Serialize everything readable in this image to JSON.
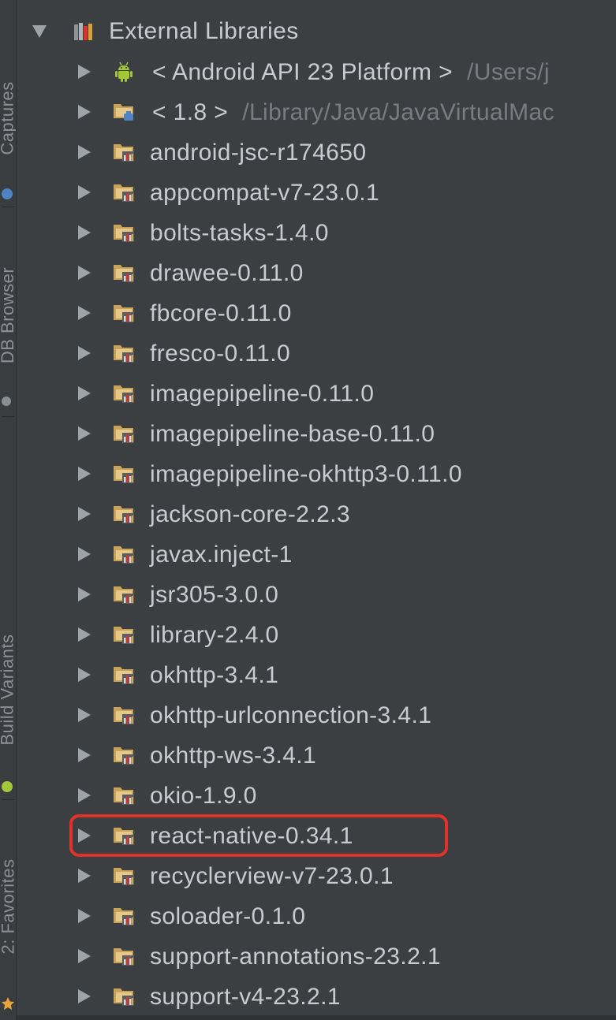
{
  "sidebar": {
    "tabs": [
      {
        "label": "Captures"
      },
      {
        "label": "DB Browser"
      },
      {
        "label": "Build Variants"
      },
      {
        "label": "2: Favorites"
      }
    ]
  },
  "tree": {
    "root": {
      "label": "External Libraries",
      "icon": "libraries-icon",
      "expanded": true
    },
    "items": [
      {
        "label": "< Android API 23 Platform >",
        "path": "/Users/j",
        "icon": "android-icon"
      },
      {
        "label": "< 1.8 >",
        "path": "/Library/Java/JavaVirtualMac",
        "icon": "jdk-folder-icon"
      },
      {
        "label": "android-jsc-r174650",
        "icon": "library-folder-icon"
      },
      {
        "label": "appcompat-v7-23.0.1",
        "icon": "library-folder-icon"
      },
      {
        "label": "bolts-tasks-1.4.0",
        "icon": "library-folder-icon"
      },
      {
        "label": "drawee-0.11.0",
        "icon": "library-folder-icon"
      },
      {
        "label": "fbcore-0.11.0",
        "icon": "library-folder-icon"
      },
      {
        "label": "fresco-0.11.0",
        "icon": "library-folder-icon"
      },
      {
        "label": "imagepipeline-0.11.0",
        "icon": "library-folder-icon"
      },
      {
        "label": "imagepipeline-base-0.11.0",
        "icon": "library-folder-icon"
      },
      {
        "label": "imagepipeline-okhttp3-0.11.0",
        "icon": "library-folder-icon"
      },
      {
        "label": "jackson-core-2.2.3",
        "icon": "library-folder-icon"
      },
      {
        "label": "javax.inject-1",
        "icon": "library-folder-icon"
      },
      {
        "label": "jsr305-3.0.0",
        "icon": "library-folder-icon"
      },
      {
        "label": "library-2.4.0",
        "icon": "library-folder-icon"
      },
      {
        "label": "okhttp-3.4.1",
        "icon": "library-folder-icon"
      },
      {
        "label": "okhttp-urlconnection-3.4.1",
        "icon": "library-folder-icon"
      },
      {
        "label": "okhttp-ws-3.4.1",
        "icon": "library-folder-icon"
      },
      {
        "label": "okio-1.9.0",
        "icon": "library-folder-icon"
      },
      {
        "label": "react-native-0.34.1",
        "icon": "library-folder-icon",
        "highlighted": true
      },
      {
        "label": "recyclerview-v7-23.0.1",
        "icon": "library-folder-icon"
      },
      {
        "label": "soloader-0.1.0",
        "icon": "library-folder-icon"
      },
      {
        "label": "support-annotations-23.2.1",
        "icon": "library-folder-icon"
      },
      {
        "label": "support-v4-23.2.1",
        "icon": "library-folder-icon"
      }
    ]
  },
  "colors": {
    "background": "#3c3f41",
    "text": "#c8ccd0",
    "path_text": "#787c80",
    "highlight_outline": "#e0312b",
    "folder": "#c9a35a",
    "android": "#a4c639"
  }
}
